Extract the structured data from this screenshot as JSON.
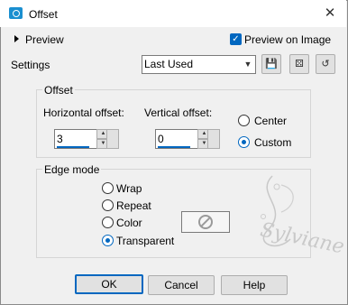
{
  "window": {
    "title": "Offset",
    "close_symbol": "✕"
  },
  "preview": {
    "toggle_label": "Preview",
    "preview_on_image_label": "Preview on Image",
    "preview_on_image_checked": true
  },
  "settings": {
    "label": "Settings",
    "preset_value": "Last Used"
  },
  "offset": {
    "group_label": "Offset",
    "horizontal_label": "Horizontal offset:",
    "horizontal_value": "3",
    "vertical_label": "Vertical offset:",
    "vertical_value": "0",
    "center_label": "Center",
    "custom_label": "Custom",
    "selected": "Custom"
  },
  "edge_mode": {
    "group_label": "Edge mode",
    "options": [
      "Wrap",
      "Repeat",
      "Color",
      "Transparent"
    ],
    "selected": "Transparent"
  },
  "buttons": {
    "ok": "OK",
    "cancel": "Cancel",
    "help": "Help"
  },
  "watermark": {
    "text": "Sylviane"
  },
  "colors": {
    "accent": "#0067c0",
    "background": "#f0f0f0"
  }
}
